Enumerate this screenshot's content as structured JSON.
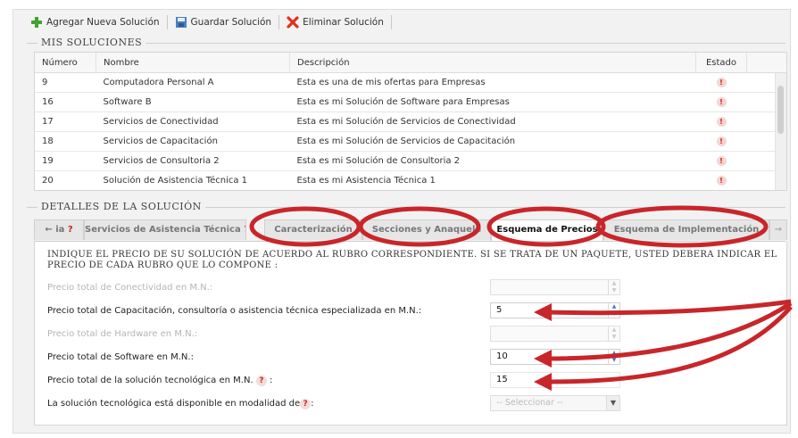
{
  "toolbar": {
    "add_label": "Agregar Nueva Solución",
    "save_label": "Guardar Solución",
    "delete_label": "Eliminar Solución"
  },
  "solutions": {
    "legend": "Mis soluciones",
    "columns": [
      "Número",
      "Nombre",
      "Descripción",
      "Estado"
    ],
    "rows": [
      {
        "num": "9",
        "name": "Computadora Personal A",
        "desc": "Esta es una de mis ofertas para Empresas"
      },
      {
        "num": "16",
        "name": "Software B",
        "desc": "Esta es mi Solución de Software para Empresas"
      },
      {
        "num": "17",
        "name": "Servicios de Conectividad",
        "desc": "Esta es mi Solución de Servicios de Conectividad"
      },
      {
        "num": "18",
        "name": "Servicios de Capacitación",
        "desc": "Esta es mi Solución de Servicios de Capacitación"
      },
      {
        "num": "19",
        "name": "Servicios de Consultoria 2",
        "desc": "Esta es mi Solución de Consultoria 2"
      },
      {
        "num": "20",
        "name": "Solución de Asistencia Técnica 1",
        "desc": "Esta es mi Asistencia Técnica 1"
      }
    ],
    "status_glyph": "!"
  },
  "details": {
    "legend": "Detalles de la Solución",
    "tabs": {
      "prev": "← ia",
      "asistencia": "Servicios de Asistencia Técnica",
      "caracterizacion": "Caracterización",
      "secciones": "Secciones y Anaquele",
      "esquema_precios": "Esquema de Precios",
      "esquema_impl": "Esquema de Implementación",
      "next": "→"
    },
    "help_glyph": "?",
    "instruction": "Indique el precio de su solución de acuerdo al rubro correspondiente. Si se trata de un paquete, usted debera indicar el precio de cada rubro que lo compone :",
    "fields": {
      "conectividad": {
        "label": "Precio total de Conectividad en M.N.:",
        "value": ""
      },
      "capacitacion": {
        "label": "Precio total de Capacitación, consultoría o asistencia técnica especializada en M.N.:",
        "value": "5"
      },
      "hardware": {
        "label": "Precio total de Hardware en M.N.:",
        "value": ""
      },
      "software": {
        "label": "Precio total de Software en M.N.:",
        "value": "10"
      },
      "solucion": {
        "label": "Precio total de la solución tecnológica en M.N. ",
        "label_suffix": ":",
        "value": "15"
      },
      "modalidad": {
        "label": "La solución tecnológica está disponible en modalidad de",
        "label_suffix": ":",
        "value": "-- Seleccionar --"
      }
    }
  },
  "colors": {
    "annotation": "#c8262a",
    "accent": "#4a78c8",
    "status": "#d21d11"
  }
}
